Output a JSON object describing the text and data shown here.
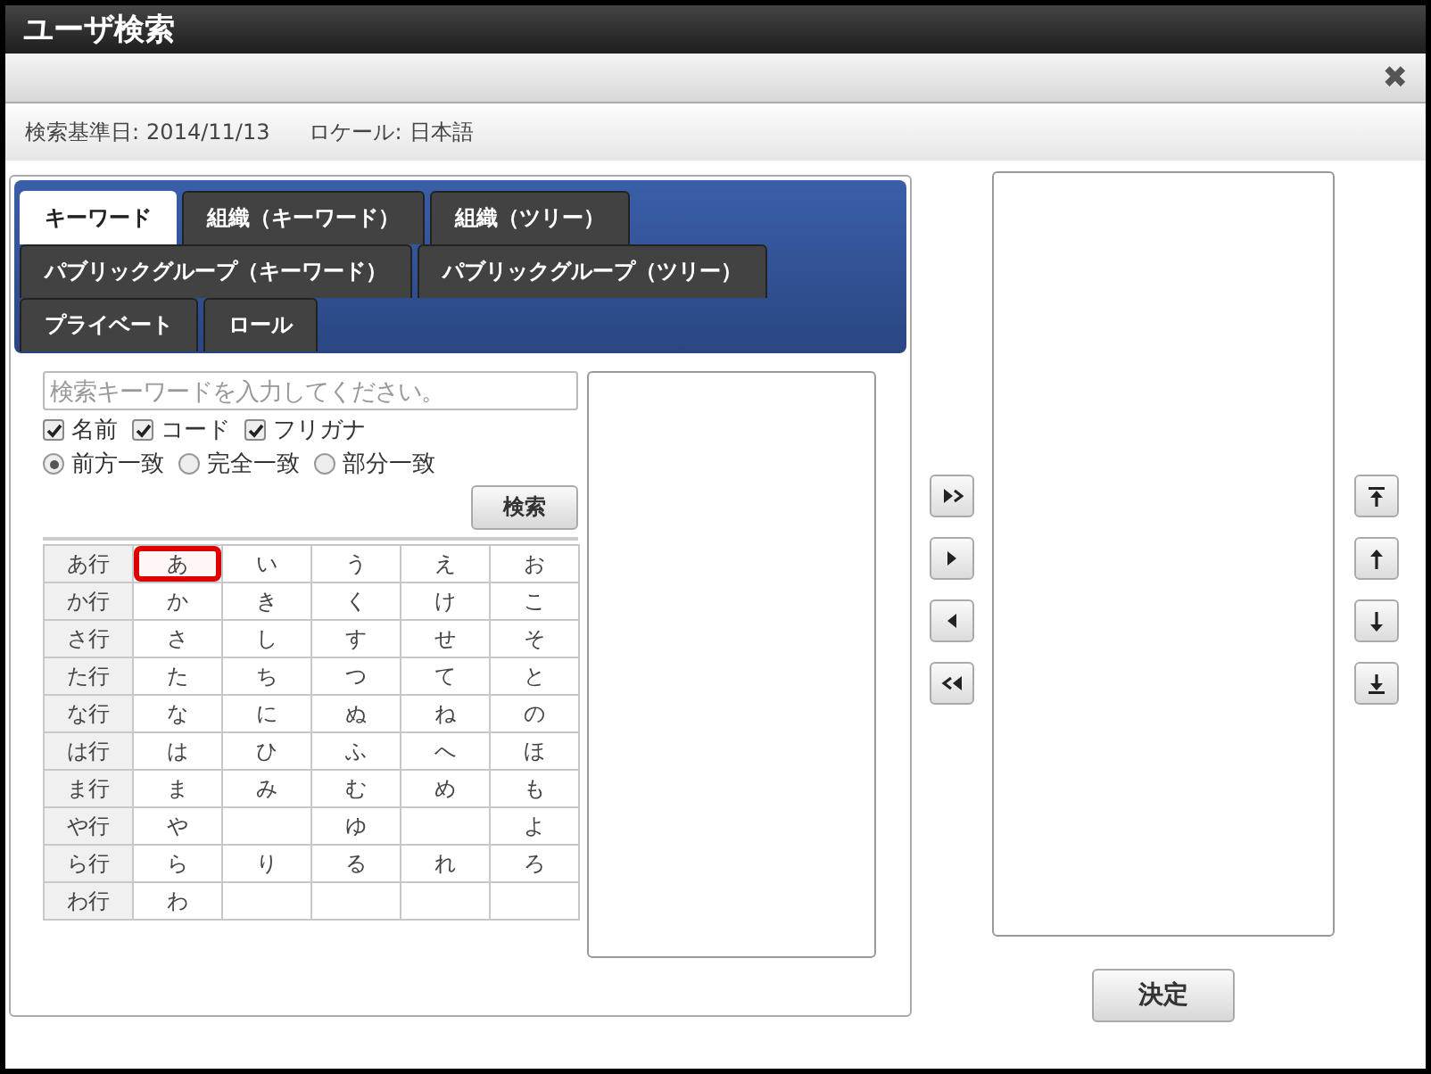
{
  "window": {
    "title": "ユーザ検索",
    "close": "✖"
  },
  "info": {
    "base_date_label": "検索基準日:",
    "base_date": "2014/11/13",
    "locale_label": "ロケール:",
    "locale": "日本語"
  },
  "tabs": [
    {
      "label": "キーワード",
      "selected": true
    },
    {
      "label": "組織（キーワード）",
      "selected": false
    },
    {
      "label": "組織（ツリー）",
      "selected": false
    },
    {
      "label": "パブリックグループ（キーワード）",
      "selected": false
    },
    {
      "label": "パブリックグループ（ツリー）",
      "selected": false
    },
    {
      "label": "プライベート",
      "selected": false
    },
    {
      "label": "ロール",
      "selected": false
    }
  ],
  "search": {
    "placeholder": "検索キーワードを入力してください。",
    "button": "検索"
  },
  "fields": [
    {
      "label": "名前",
      "checked": true
    },
    {
      "label": "コード",
      "checked": true
    },
    {
      "label": "フリガナ",
      "checked": true
    }
  ],
  "match_modes": [
    {
      "label": "前方一致",
      "selected": true
    },
    {
      "label": "完全一致",
      "selected": false
    },
    {
      "label": "部分一致",
      "selected": false
    }
  ],
  "kana_rows": [
    {
      "header": "あ行",
      "cells": [
        {
          "text": "あ",
          "selected": true
        },
        {
          "text": "い",
          "selected": false
        },
        {
          "text": "う",
          "selected": false
        },
        {
          "text": "え",
          "selected": false
        },
        {
          "text": "お",
          "selected": false
        }
      ]
    },
    {
      "header": "か行",
      "cells": [
        {
          "text": "か",
          "selected": false
        },
        {
          "text": "き",
          "selected": false
        },
        {
          "text": "く",
          "selected": false
        },
        {
          "text": "け",
          "selected": false
        },
        {
          "text": "こ",
          "selected": false
        }
      ]
    },
    {
      "header": "さ行",
      "cells": [
        {
          "text": "さ",
          "selected": false
        },
        {
          "text": "し",
          "selected": false
        },
        {
          "text": "す",
          "selected": false
        },
        {
          "text": "せ",
          "selected": false
        },
        {
          "text": "そ",
          "selected": false
        }
      ]
    },
    {
      "header": "た行",
      "cells": [
        {
          "text": "た",
          "selected": false
        },
        {
          "text": "ち",
          "selected": false
        },
        {
          "text": "つ",
          "selected": false
        },
        {
          "text": "て",
          "selected": false
        },
        {
          "text": "と",
          "selected": false
        }
      ]
    },
    {
      "header": "な行",
      "cells": [
        {
          "text": "な",
          "selected": false
        },
        {
          "text": "に",
          "selected": false
        },
        {
          "text": "ぬ",
          "selected": false
        },
        {
          "text": "ね",
          "selected": false
        },
        {
          "text": "の",
          "selected": false
        }
      ]
    },
    {
      "header": "は行",
      "cells": [
        {
          "text": "は",
          "selected": false
        },
        {
          "text": "ひ",
          "selected": false
        },
        {
          "text": "ふ",
          "selected": false
        },
        {
          "text": "へ",
          "selected": false
        },
        {
          "text": "ほ",
          "selected": false
        }
      ]
    },
    {
      "header": "ま行",
      "cells": [
        {
          "text": "ま",
          "selected": false
        },
        {
          "text": "み",
          "selected": false
        },
        {
          "text": "む",
          "selected": false
        },
        {
          "text": "め",
          "selected": false
        },
        {
          "text": "も",
          "selected": false
        }
      ]
    },
    {
      "header": "や行",
      "cells": [
        {
          "text": "や",
          "selected": false
        },
        {
          "selected": false
        },
        {
          "text": "ゆ",
          "selected": false
        },
        {
          "selected": false
        },
        {
          "text": "よ",
          "selected": false
        }
      ]
    },
    {
      "header": "ら行",
      "cells": [
        {
          "text": "ら",
          "selected": false
        },
        {
          "text": "り",
          "selected": false
        },
        {
          "text": "る",
          "selected": false
        },
        {
          "text": "れ",
          "selected": false
        },
        {
          "text": "ろ",
          "selected": false
        }
      ]
    },
    {
      "header": "わ行",
      "cells": [
        {
          "text": "わ",
          "selected": false
        },
        {
          "selected": false
        },
        {
          "selected": false
        },
        {
          "selected": false
        },
        {
          "selected": false
        }
      ]
    }
  ],
  "transfer_buttons": [
    {
      "kind": "add-all"
    },
    {
      "kind": "add"
    },
    {
      "kind": "remove"
    },
    {
      "kind": "remove-all"
    }
  ],
  "order_buttons": [
    {
      "kind": "top"
    },
    {
      "kind": "up"
    },
    {
      "kind": "down"
    },
    {
      "kind": "bottom"
    }
  ],
  "confirm_button": "決定"
}
